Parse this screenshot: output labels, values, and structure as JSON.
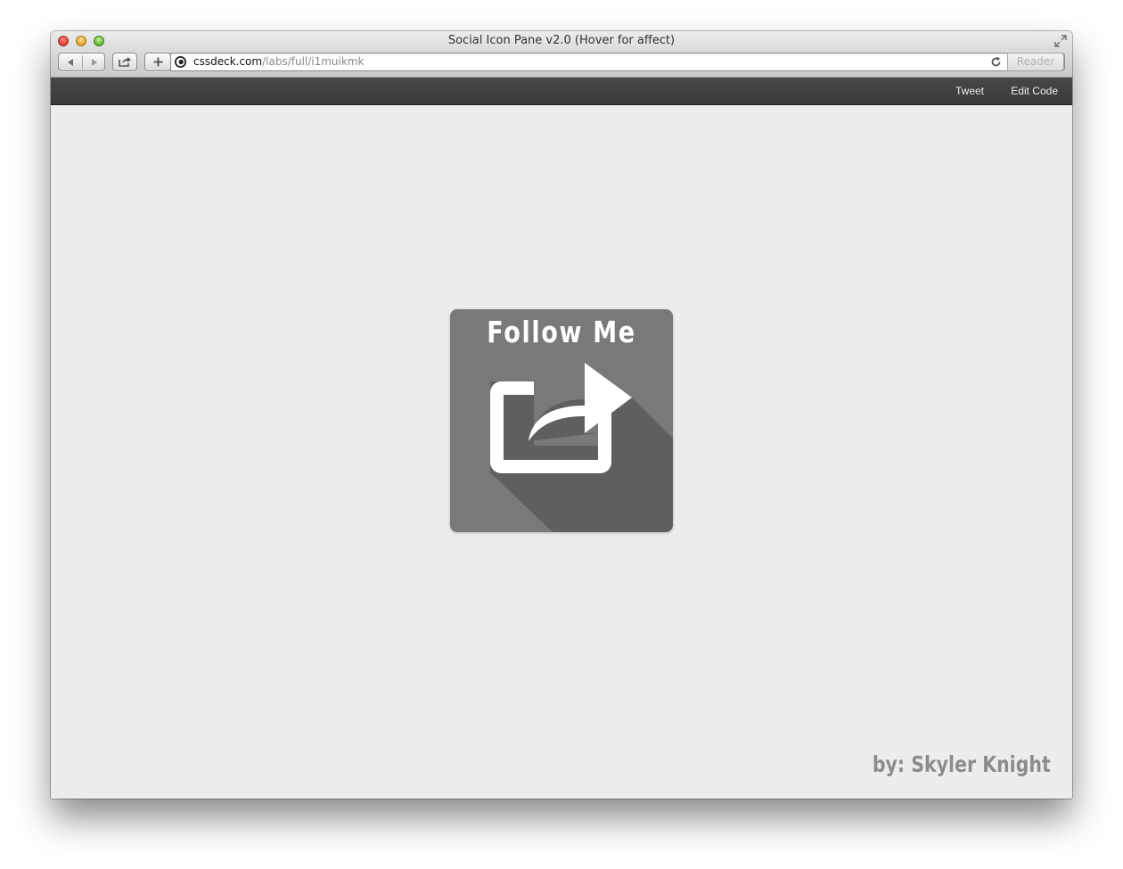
{
  "window": {
    "title": "Social Icon Pane v2.0 (Hover for affect)"
  },
  "browser": {
    "url_domain": "cssdeck.com",
    "url_path": "/labs/full/i1muikmk",
    "reader_label": "Reader"
  },
  "toolbar": {
    "tweet_label": "Tweet",
    "edit_code_label": "Edit Code"
  },
  "pane": {
    "title": "Follow Me",
    "icon": "share-arrow-icon",
    "background_color": "#797979",
    "shadow_color": "#5f5f5f"
  },
  "footer": {
    "byline": "by: Skyler Knight"
  }
}
